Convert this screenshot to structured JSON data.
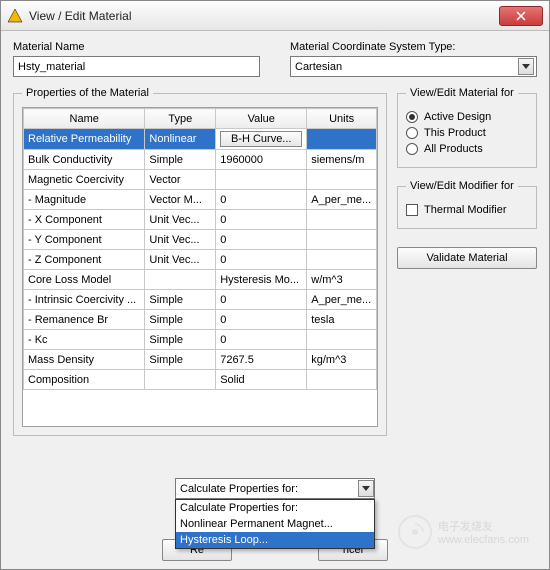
{
  "window": {
    "title": "View / Edit Material"
  },
  "material_name_label": "Material Name",
  "material_name_value": "Hsty_material",
  "coord_label": "Material Coordinate System Type:",
  "coord_value": "Cartesian",
  "props_legend": "Properties of the Material",
  "columns": {
    "name": "Name",
    "type": "Type",
    "value": "Value",
    "units": "Units"
  },
  "rows": [
    {
      "name": "Relative Permeability",
      "type": "Nonlinear",
      "value": "B-H Curve...",
      "units": "",
      "selected": true,
      "value_is_button": true
    },
    {
      "name": "Bulk Conductivity",
      "type": "Simple",
      "value": "1960000",
      "units": "siemens/m"
    },
    {
      "name": "Magnetic Coercivity",
      "type": "Vector",
      "value": "",
      "units": ""
    },
    {
      "name": "- Magnitude",
      "type": "Vector M...",
      "value": "0",
      "units": "A_per_me..."
    },
    {
      "name": "- X Component",
      "type": "Unit Vec...",
      "value": "0",
      "units": ""
    },
    {
      "name": "- Y Component",
      "type": "Unit Vec...",
      "value": "0",
      "units": ""
    },
    {
      "name": "- Z Component",
      "type": "Unit Vec...",
      "value": "0",
      "units": ""
    },
    {
      "name": "Core Loss Model",
      "type": "",
      "value": "Hysteresis Mo...",
      "units": "w/m^3"
    },
    {
      "name": "- Intrinsic Coercivity ...",
      "type": "Simple",
      "value": "0",
      "units": "A_per_me..."
    },
    {
      "name": "- Remanence Br",
      "type": "Simple",
      "value": "0",
      "units": "tesla"
    },
    {
      "name": "- Kc",
      "type": "Simple",
      "value": "0",
      "units": ""
    },
    {
      "name": "Mass Density",
      "type": "Simple",
      "value": "7267.5",
      "units": "kg/m^3"
    },
    {
      "name": "Composition",
      "type": "",
      "value": "Solid",
      "units": ""
    }
  ],
  "view_edit_legend": "View/Edit Material for",
  "radios": [
    {
      "label": "Active Design",
      "checked": true
    },
    {
      "label": "This Product",
      "checked": false
    },
    {
      "label": "All Products",
      "checked": false
    }
  ],
  "modifier_legend": "View/Edit Modifier for",
  "thermal_modifier": "Thermal Modifier",
  "validate_label": "Validate Material",
  "calc_label": "Calculate Properties for:",
  "dropdown_options": [
    {
      "label": "Calculate Properties for:",
      "hover": false
    },
    {
      "label": "Nonlinear Permanent Magnet...",
      "hover": false
    },
    {
      "label": "Hysteresis Loop...",
      "hover": true
    }
  ],
  "buttons": {
    "reset": "Re",
    "cancel": "ncel"
  },
  "watermark": {
    "url": "www.elecfans.com",
    "brand": "电子发烧友"
  }
}
